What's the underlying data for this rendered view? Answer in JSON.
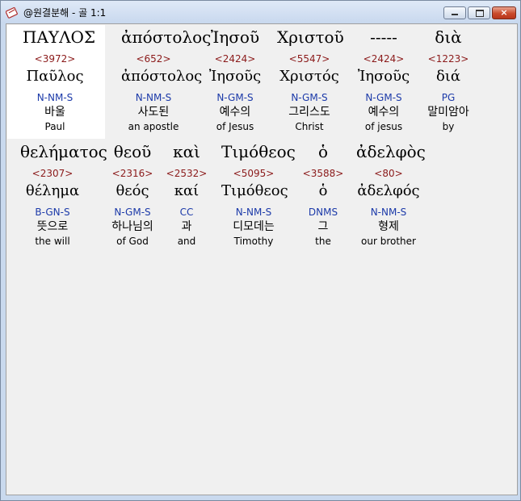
{
  "window": {
    "title": "@원결분해 - 골 1:1"
  },
  "controls": {
    "minimize": "minimize",
    "maximize": "maximize",
    "close": "×"
  },
  "words": [
    {
      "greek": "ΠΑΥΛΟΣ",
      "strong": "<3972>",
      "lemma": "Παῦλος",
      "parse": "N-NM-S",
      "korean": "바울",
      "english": "Paul"
    },
    {
      "greek": "ἀπόστολος",
      "strong": "<652>",
      "lemma": "ἀπόστολος",
      "parse": "N-NM-S",
      "korean": "사도된",
      "english": "an apostle"
    },
    {
      "greek": "Ἰησοῦ",
      "strong": "<2424>",
      "lemma": "Ἰησοῦς",
      "parse": "N-GM-S",
      "korean": "예수의",
      "english": "of Jesus"
    },
    {
      "greek": "Χριστοῦ",
      "strong": "<5547>",
      "lemma": "Χριστός",
      "parse": "N-GM-S",
      "korean": "그리스도",
      "english": "Christ"
    },
    {
      "greek": "-----",
      "strong": "<2424>",
      "lemma": "Ἰησοῦς",
      "parse": "N-GM-S",
      "korean": "예수의",
      "english": "of jesus"
    },
    {
      "greek": "διὰ",
      "strong": "<1223>",
      "lemma": "διά",
      "parse": "PG",
      "korean": "말미암아",
      "english": "by"
    },
    {
      "greek": "θελήματος",
      "strong": "<2307>",
      "lemma": "θέλημα",
      "parse": "B-GN-S",
      "korean": "뜻으로",
      "english": "the will"
    },
    {
      "greek": "θεοῦ",
      "strong": "<2316>",
      "lemma": "θεός",
      "parse": "N-GM-S",
      "korean": "하나님의",
      "english": "of God"
    },
    {
      "greek": "καὶ",
      "strong": "<2532>",
      "lemma": "καί",
      "parse": "CC",
      "korean": "과",
      "english": "and"
    },
    {
      "greek": "Τιμόθεος",
      "strong": "<5095>",
      "lemma": "Τιμόθεος",
      "parse": "N-NM-S",
      "korean": "디모데는",
      "english": "Timothy"
    },
    {
      "greek": "ὁ",
      "strong": "<3588>",
      "lemma": "ὁ",
      "parse": "DNMS",
      "korean": "그",
      "english": "the"
    },
    {
      "greek": "ἀδελφὸς",
      "strong": "<80>",
      "lemma": "ἀδελφός",
      "parse": "N-NM-S",
      "korean": "형제",
      "english": "our brother"
    }
  ]
}
